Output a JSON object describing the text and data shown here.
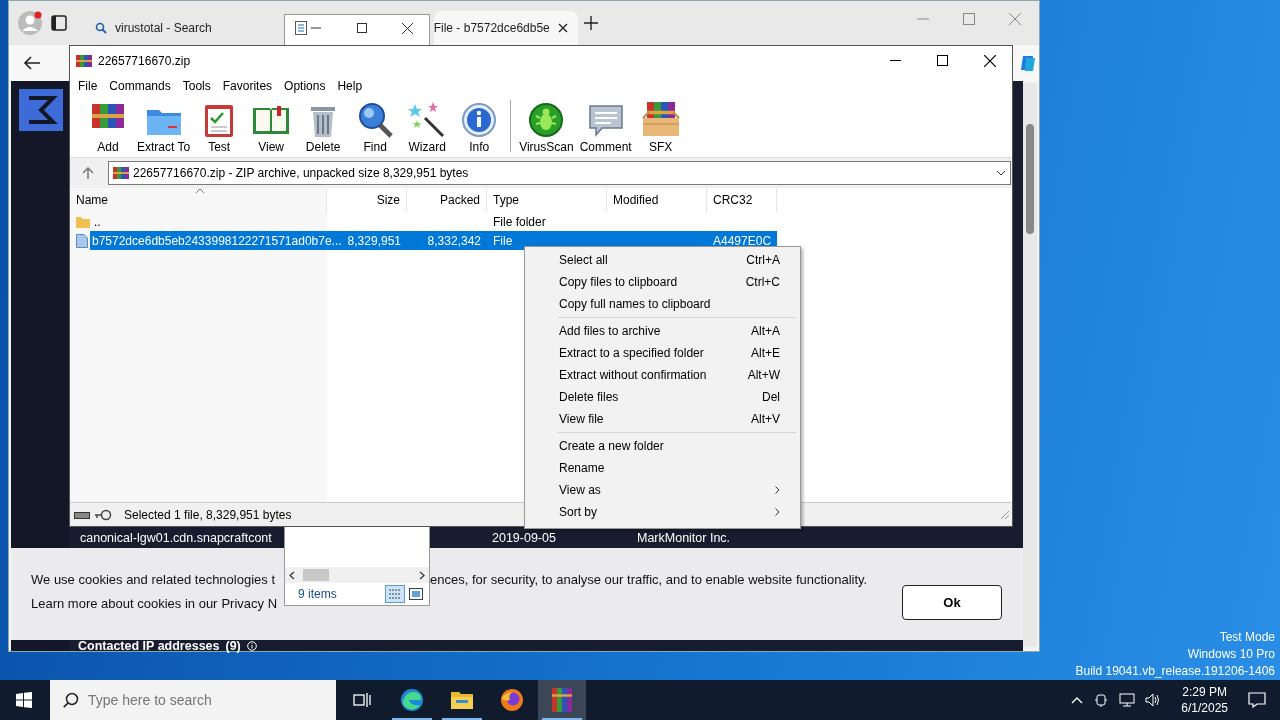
{
  "browser": {
    "tabs": [
      {
        "label": "virustotal - Search",
        "selected": false
      },
      {
        "label": "File - b7572dce6db5e",
        "selected": true
      }
    ],
    "page": {
      "rows": [
        {
          "domain": "canonical-lgw01.cdn.snapcraftcont",
          "date": "2019-09-05",
          "registrar": "MarkMonitor Inc."
        }
      ],
      "cookie": {
        "line_1_start": "We use cookies and related technologies t",
        "line_1_end": "ences, for security, to analyse our traffic, and to enable website functionality.",
        "line_2": "Learn more about cookies in our",
        "link": "Privacy N",
        "button": "Ok"
      },
      "section": {
        "title": "Contacted IP addresses",
        "count": "(9)"
      }
    }
  },
  "explorer": {
    "status": "9 items"
  },
  "winrar": {
    "title": "22657716670.zip",
    "menu": [
      "File",
      "Commands",
      "Tools",
      "Favorites",
      "Options",
      "Help"
    ],
    "toolbar": [
      [
        {
          "label": "Add",
          "kind": "add"
        },
        {
          "label": "Extract To",
          "kind": "extract"
        },
        {
          "label": "Test",
          "kind": "test"
        },
        {
          "label": "View",
          "kind": "view"
        },
        {
          "label": "Delete",
          "kind": "delete"
        },
        {
          "label": "Find",
          "kind": "find"
        },
        {
          "label": "Wizard",
          "kind": "wizard"
        },
        {
          "label": "Info",
          "kind": "info"
        }
      ],
      [
        {
          "label": "VirusScan",
          "kind": "virusscan"
        },
        {
          "label": "Comment",
          "kind": "comment"
        },
        {
          "label": "SFX",
          "kind": "sfx"
        }
      ]
    ],
    "path": "22657716670.zip - ZIP archive, unpacked size 8,329,951 bytes",
    "columns": [
      "Name",
      "Size",
      "Packed",
      "Type",
      "Modified",
      "CRC32"
    ],
    "rows": [
      {
        "kind": "folder",
        "name": "..",
        "type": "File folder",
        "selected": false
      },
      {
        "kind": "file",
        "name": "b7572dce6db5eb2433998122271571ad0b7e...",
        "size": "8,329,951",
        "packed": "8,332,342",
        "type": "File",
        "crc": "A4497E0C",
        "selected": true
      }
    ],
    "status": "Selected 1 file, 8,329,951 bytes"
  },
  "context_menu": [
    [
      {
        "label": "Select all",
        "shortcut": "Ctrl+A",
        "submenu": false
      },
      {
        "label": "Copy files to clipboard",
        "shortcut": "Ctrl+C",
        "submenu": false
      },
      {
        "label": "Copy full names to clipboard",
        "submenu": false
      }
    ],
    [
      {
        "label": "Add files to archive",
        "shortcut": "Alt+A",
        "submenu": false
      },
      {
        "label": "Extract to a specified folder",
        "shortcut": "Alt+E",
        "submenu": false
      },
      {
        "label": "Extract without confirmation",
        "shortcut": "Alt+W",
        "submenu": false
      },
      {
        "label": "Delete files",
        "shortcut": "Del",
        "submenu": false
      },
      {
        "label": "View file",
        "shortcut": "Alt+V",
        "submenu": false
      }
    ],
    [
      {
        "label": "Create a new folder",
        "submenu": false
      },
      {
        "label": "Rename",
        "submenu": false
      },
      {
        "label": "View as",
        "submenu": true
      },
      {
        "label": "Sort by",
        "submenu": true
      }
    ]
  ],
  "desktop_text": [
    "Test Mode",
    "Windows 10 Pro",
    "Build 19041.vb_release.191206-1406"
  ],
  "taskbar": {
    "search_placeholder": "Type here to search",
    "apps": [
      {
        "kind": "edge",
        "running": true,
        "selected": false
      },
      {
        "kind": "explorer",
        "running": true,
        "selected": false
      },
      {
        "kind": "firefox",
        "running": false,
        "selected": false
      },
      {
        "kind": "winrar",
        "running": true,
        "selected": true
      }
    ],
    "time": "2:29 PM",
    "date": "6/1/2025"
  }
}
